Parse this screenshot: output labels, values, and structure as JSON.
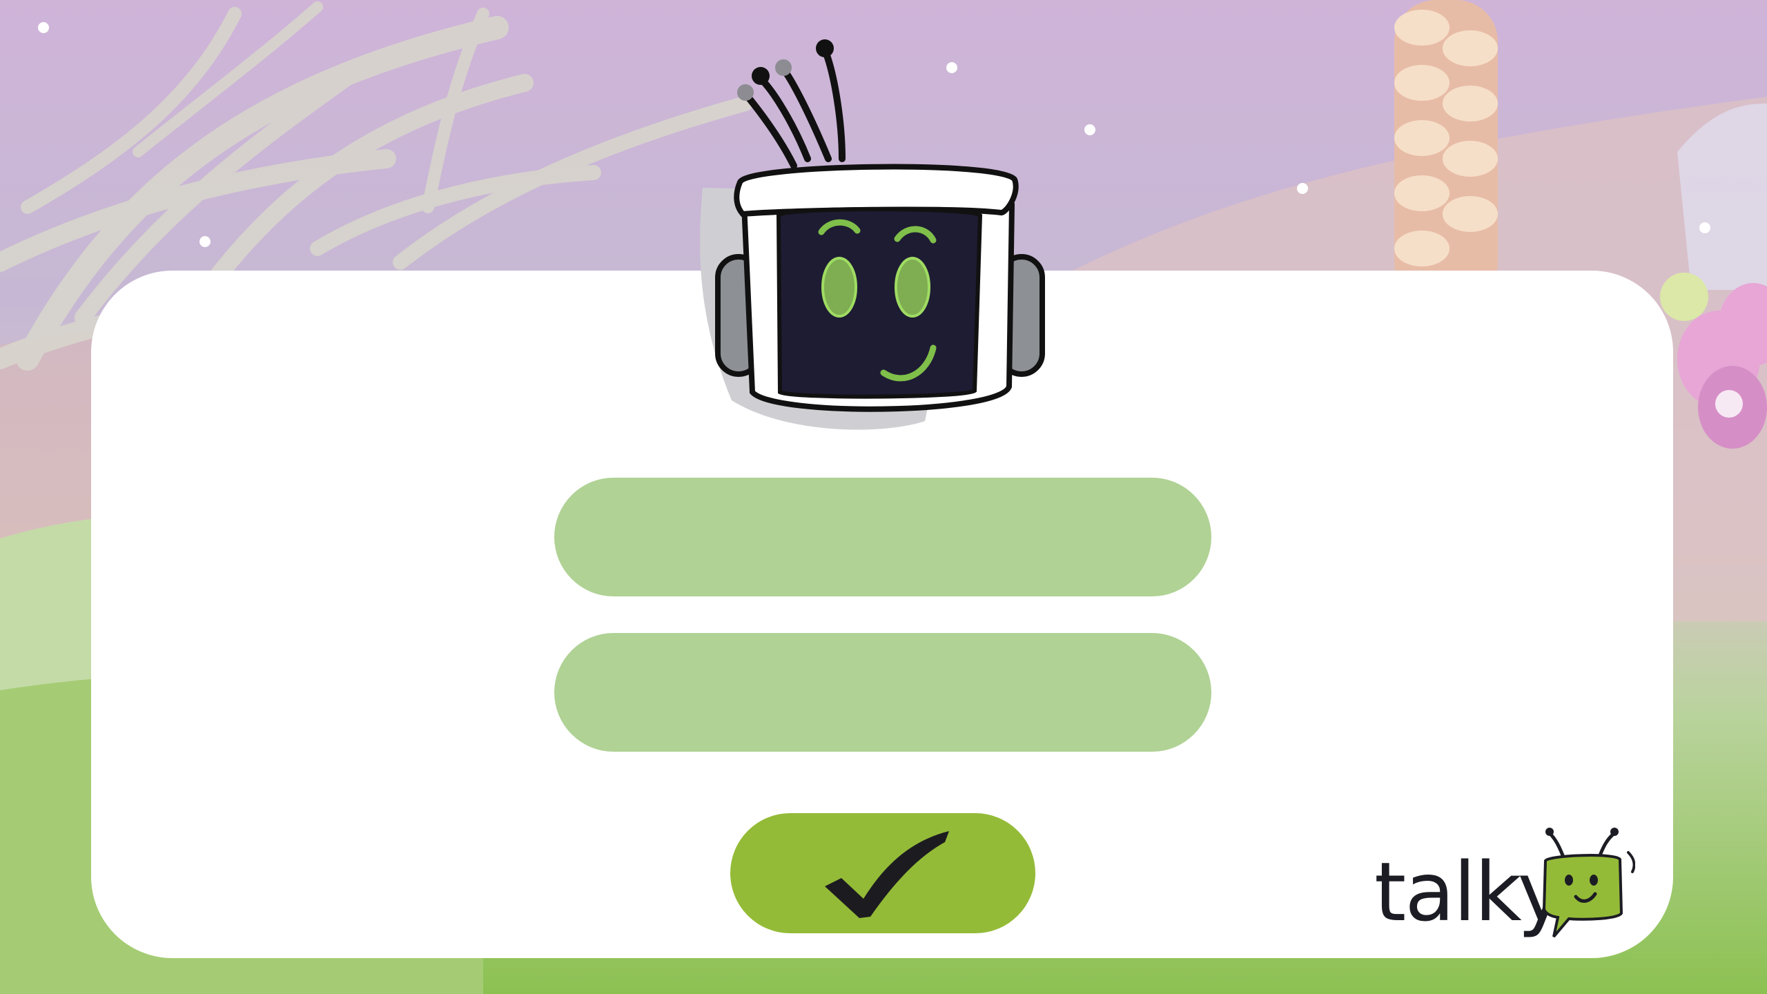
{
  "login": {
    "username_value": "",
    "password_value": ""
  },
  "brand": {
    "logo_text": "talky",
    "colors": {
      "accent": "#94bb37",
      "field": "#b0d295",
      "screen": "#1e1c33",
      "face": "#7fbf4a"
    }
  },
  "icons": {
    "submit": "checkmark-icon",
    "mascot": "robot-mascot"
  }
}
